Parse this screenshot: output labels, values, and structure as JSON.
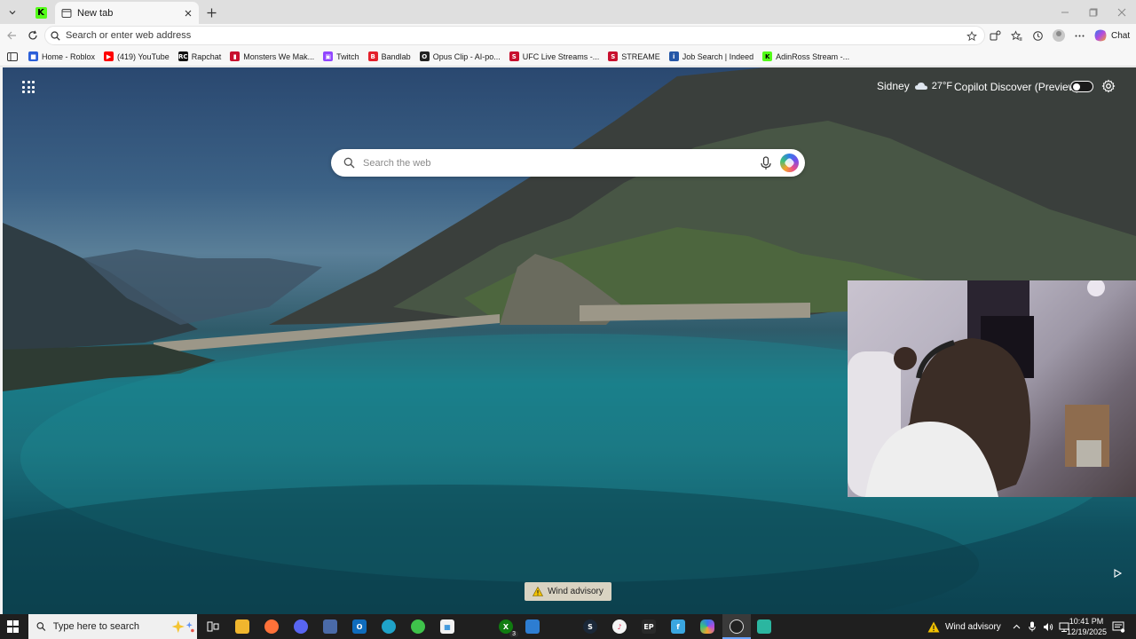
{
  "browser": {
    "active_tab": {
      "title": "New tab"
    },
    "address_bar": {
      "placeholder": "Search or enter web address"
    },
    "chat_label": "Chat"
  },
  "bookmarks": [
    {
      "label": "Home - Roblox",
      "icon": "roblox-icon",
      "color": "#2b5fd9"
    },
    {
      "label": "(419) YouTube",
      "icon": "youtube-icon",
      "color": "#ff0000"
    },
    {
      "label": "Rapchat",
      "icon": "rapchat-icon",
      "color": "#111111"
    },
    {
      "label": "Monsters We Mak...",
      "icon": "bookmark-red-icon",
      "color": "#c8102e"
    },
    {
      "label": "Twitch",
      "icon": "twitch-icon",
      "color": "#9146ff"
    },
    {
      "label": "Bandlab",
      "icon": "bandlab-icon",
      "color": "#e4202b"
    },
    {
      "label": "Opus Clip - AI-po...",
      "icon": "opus-clip-icon",
      "color": "#222222"
    },
    {
      "label": "UFC Live Streams -...",
      "icon": "streameast-icon",
      "color": "#c8102e"
    },
    {
      "label": "STREAME",
      "icon": "streameast-icon",
      "color": "#c8102e"
    },
    {
      "label": "Job Search | Indeed",
      "icon": "indeed-icon",
      "color": "#2557a7"
    },
    {
      "label": "AdinRoss Stream -...",
      "icon": "kick-icon",
      "color": "#53fc18"
    }
  ],
  "newtab": {
    "search_placeholder": "Search the web",
    "weather": {
      "city": "Sidney",
      "temp": "27°F"
    },
    "copilot_discover_label": "Copilot Discover (Preview)",
    "copilot_discover_enabled": true,
    "advisory": "Wind advisory"
  },
  "taskbar": {
    "search_placeholder": "Type here to search",
    "xbox_badge": "3",
    "tray_advisory": "Wind advisory",
    "time": "10:41 PM",
    "date": "12/19/2025"
  },
  "colors": {
    "accent": "#53fc18",
    "toolbar_bg": "#f7f7f7",
    "tabstrip_bg": "#dfdfdf",
    "taskbar_bg": "#1f1f1f"
  }
}
